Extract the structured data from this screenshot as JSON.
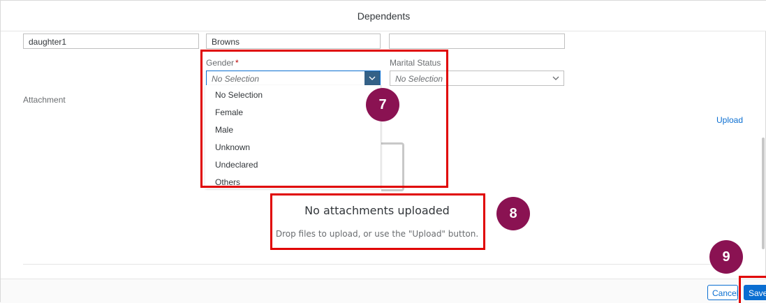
{
  "dialog": {
    "title": "Dependents"
  },
  "name_fields": {
    "first_name": "daughter1",
    "last_name": "Browns",
    "third": ""
  },
  "gender": {
    "label": "Gender",
    "required_marker": "*",
    "value": "No Selection",
    "options": [
      "No Selection",
      "Female",
      "Male",
      "Unknown",
      "Undeclared",
      "Others"
    ]
  },
  "marital_status": {
    "label": "Marital Status",
    "value": "No Selection"
  },
  "attachment": {
    "label": "Attachment",
    "upload_link": "Upload",
    "empty_title": "No attachments uploaded",
    "empty_description": "Drop files to upload, or use the \"Upload\" button."
  },
  "footer": {
    "cancel_label": "Cancel",
    "save_label": "Save"
  },
  "callouts": {
    "step7": "7",
    "step8": "8",
    "step9": "9"
  },
  "colors": {
    "highlight": "#e00000",
    "badge": "#8a1252",
    "accent": "#0a6ed1",
    "dropdown_arrow_bg": "#346187"
  },
  "icons": {
    "dropdown_arrow": "chevron-down-icon"
  }
}
